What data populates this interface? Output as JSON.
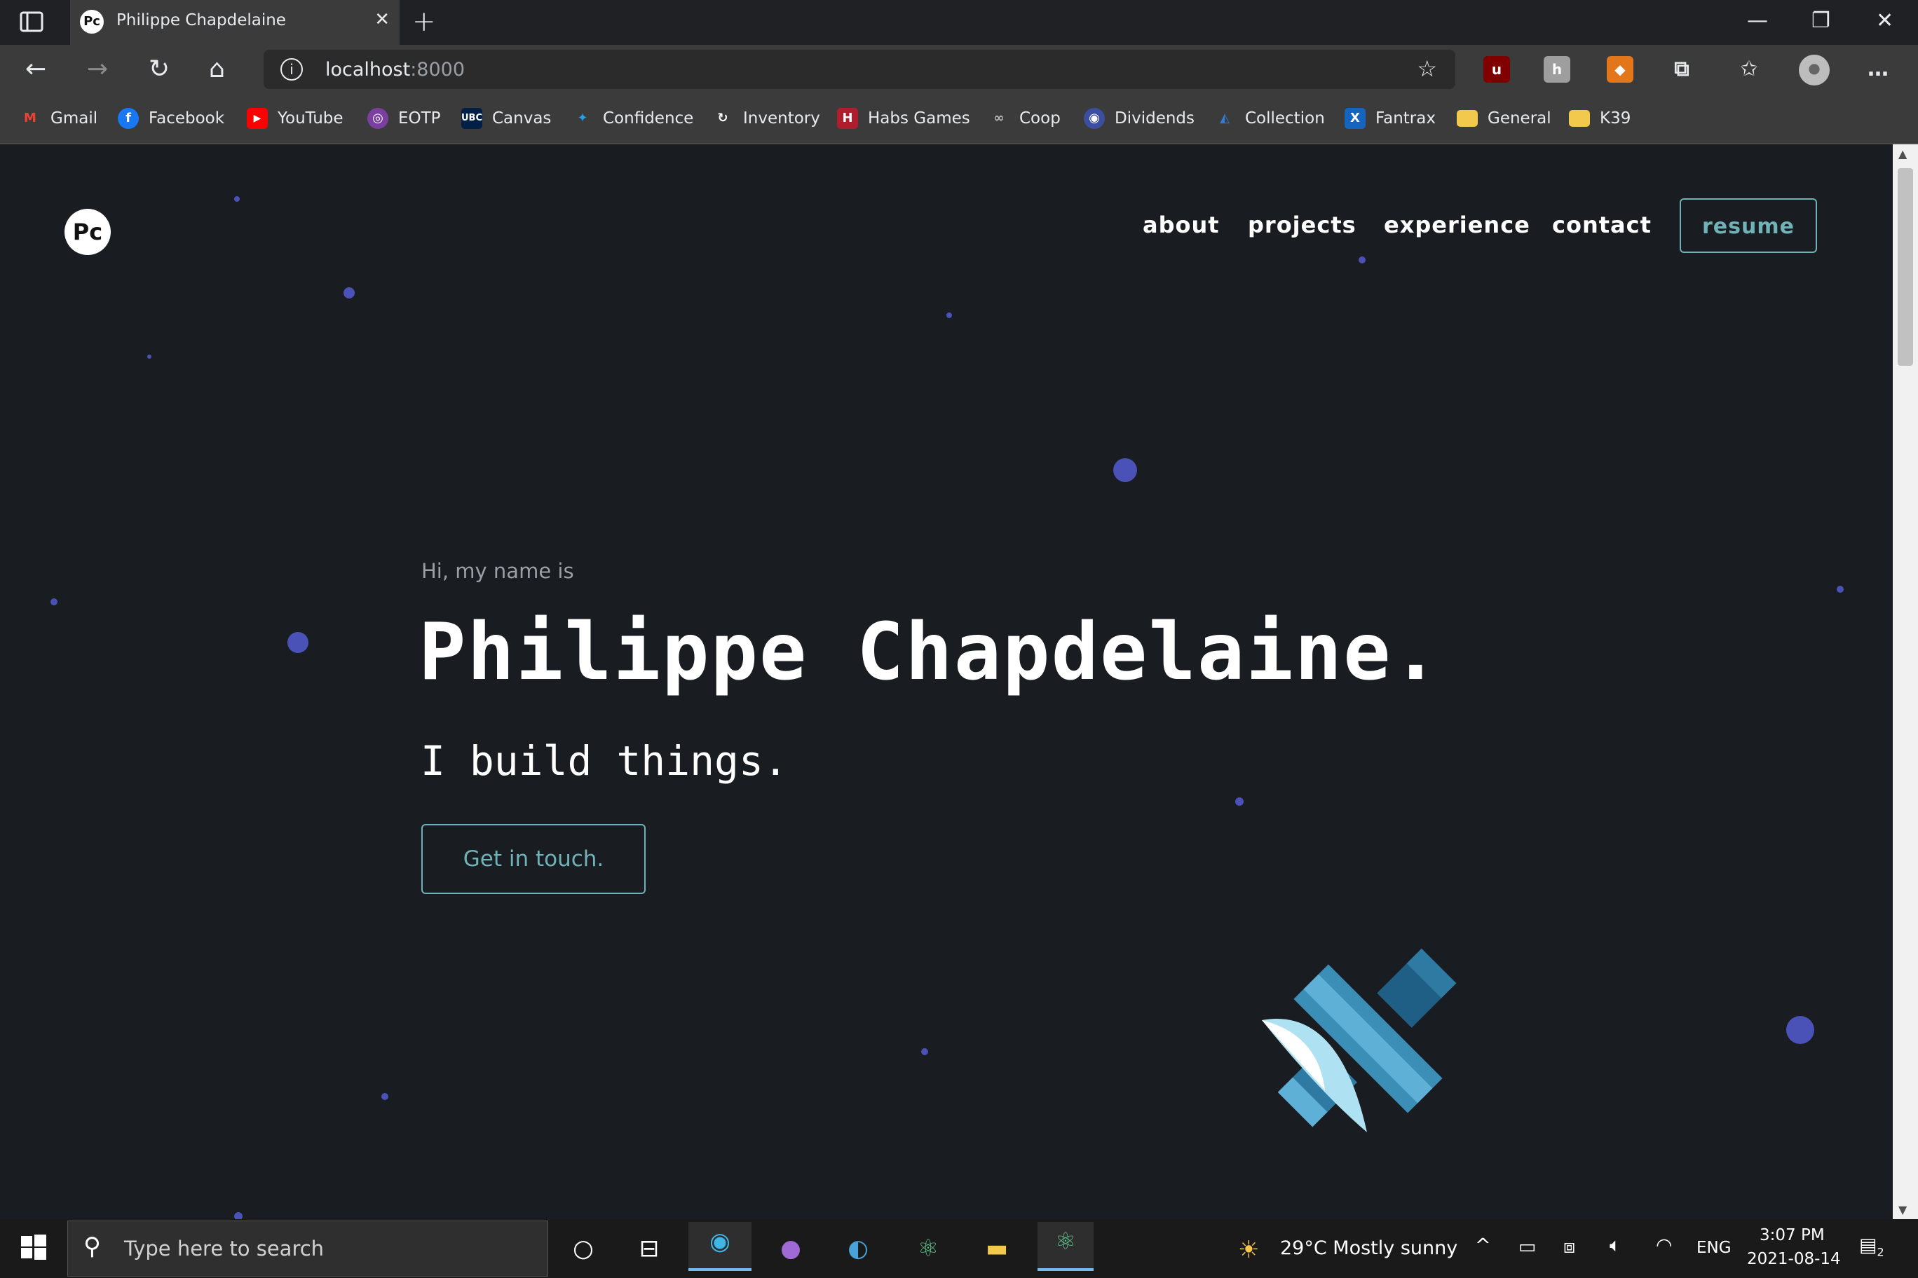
{
  "browser": {
    "tab_title": "Philippe Chapdelaine",
    "favicon_text": "Pc",
    "url_host": "localhost",
    "url_port": ":8000"
  },
  "bookmarks": [
    {
      "label": "Gmail",
      "icon": "gmail-icon",
      "color": "#ea4335",
      "glyph": "M"
    },
    {
      "label": "Facebook",
      "icon": "facebook-icon",
      "color": "#1877f2",
      "glyph": "f"
    },
    {
      "label": "YouTube",
      "icon": "youtube-icon",
      "color": "#ff0000",
      "glyph": "▶"
    },
    {
      "label": "EOTP",
      "icon": "eotp-icon",
      "color": "#7b3fa0",
      "glyph": "◎"
    },
    {
      "label": "Canvas",
      "icon": "ubc-icon",
      "color": "#002145",
      "glyph": "U"
    },
    {
      "label": "Confidence",
      "icon": "twitter-icon",
      "color": "#1da1f2",
      "glyph": "✦"
    },
    {
      "label": "Inventory",
      "icon": "inventory-icon",
      "color": "#555555",
      "glyph": "↻"
    },
    {
      "label": "Habs Games",
      "icon": "habs-icon",
      "color": "#af1e2d",
      "glyph": "H"
    },
    {
      "label": "Coop",
      "icon": "coop-icon",
      "color": "#666666",
      "glyph": "∞"
    },
    {
      "label": "Dividends",
      "icon": "dividends-icon",
      "color": "#3b4ea0",
      "glyph": "◉"
    },
    {
      "label": "Collection",
      "icon": "collection-icon",
      "color": "#2f7bd9",
      "glyph": "◭"
    },
    {
      "label": "Fantrax",
      "icon": "fantrax-icon",
      "color": "#1565c0",
      "glyph": "X"
    },
    {
      "label": "General",
      "icon": "folder-icon",
      "color": "#f2c94c",
      "glyph": ""
    },
    {
      "label": "K39",
      "icon": "folder-icon",
      "color": "#f2c94c",
      "glyph": ""
    }
  ],
  "site": {
    "logo_text": "Pc",
    "nav": [
      "about",
      "projects",
      "experience",
      "contact"
    ],
    "resume_label": "resume",
    "greeting": "Hi, my name is",
    "name": "Philippe Chapdelaine.",
    "tagline": "I build things.",
    "cta_label": "Get in touch."
  },
  "taskbar": {
    "search_placeholder": "Type here to search",
    "weather": "29°C  Mostly sunny",
    "lang": "ENG",
    "time": "3:07 PM",
    "date": "2021-08-14",
    "notifications": "2"
  }
}
